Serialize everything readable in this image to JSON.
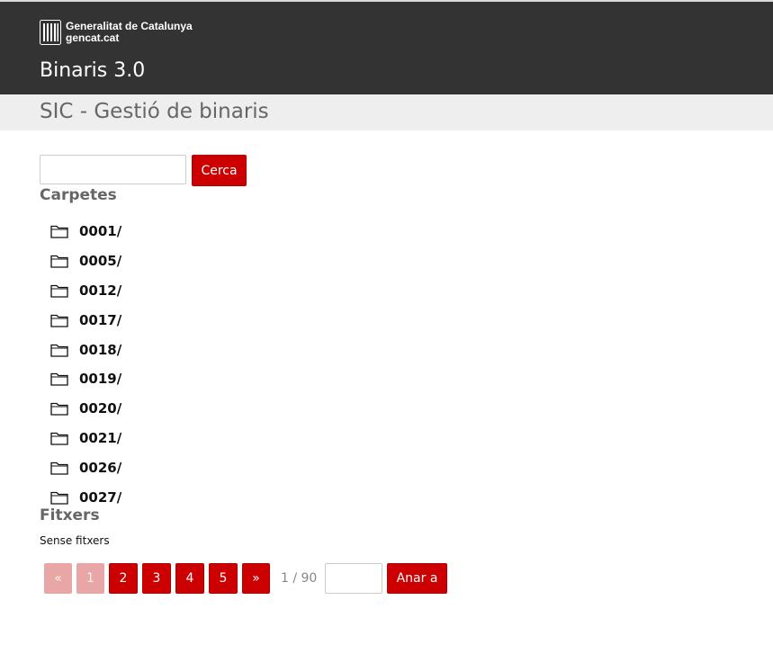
{
  "header": {
    "logo_line1": "Generalitat de Catalunya",
    "logo_line2": "gencat.cat",
    "app_title": "Binaris 3.0",
    "background": "#333333"
  },
  "subheader": {
    "page_title": "SIC - Gestió de binaris"
  },
  "search": {
    "value": "",
    "placeholder": "",
    "button_label": "Cerca"
  },
  "folders": {
    "title": "Carpetes",
    "icon": "folder-icon",
    "items": [
      {
        "label": "0001/"
      },
      {
        "label": "0005/"
      },
      {
        "label": "0012/"
      },
      {
        "label": "0017/"
      },
      {
        "label": "0018/"
      },
      {
        "label": "0019/"
      },
      {
        "label": "0020/"
      },
      {
        "label": "0021/"
      },
      {
        "label": "0026/"
      },
      {
        "label": "0027/"
      }
    ]
  },
  "files": {
    "title": "Fitxers",
    "empty_text": "Sense fitxers"
  },
  "pagination": {
    "first_label": "«",
    "pages": [
      "1",
      "2",
      "3",
      "4",
      "5"
    ],
    "current_page": "1",
    "next_label": "»",
    "page_count": "1 / 90",
    "goto_value": "",
    "goto_label": "Anar a"
  },
  "colors": {
    "accent": "#cc0000",
    "accent_disabled": "#e8a6a6",
    "header_bg": "#333333",
    "subheader_bg": "#eeeeee",
    "title_gray": "#666666"
  }
}
